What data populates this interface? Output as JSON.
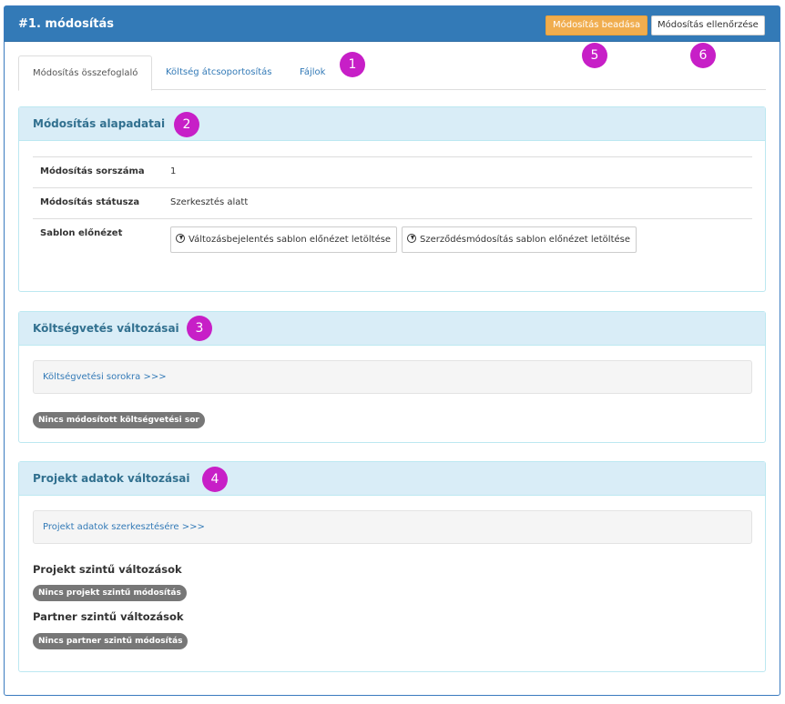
{
  "header": {
    "title": "#1. módosítás",
    "submit_label": "Módosítás beadása",
    "check_label": "Módosítás ellenőrzése"
  },
  "tabs": [
    {
      "label": "Módosítás összefoglaló",
      "active": true
    },
    {
      "label": "Költség átcsoportosítás",
      "active": false
    },
    {
      "label": "Fájlok",
      "active": false
    }
  ],
  "markers": [
    "1",
    "2",
    "3",
    "4",
    "5",
    "6"
  ],
  "basic": {
    "title": "Módosítás alapadatai",
    "rows": [
      {
        "label": "Módosítás sorszáma",
        "value": "1"
      },
      {
        "label": "Módosítás státusza",
        "value": "Szerkesztés alatt"
      },
      {
        "label": "Sablon előnézet"
      }
    ],
    "download_buttons": [
      "Változásbejelentés sablon előnézet letöltése",
      "Szerződésmódosítás sablon előnézet letöltése"
    ]
  },
  "budget": {
    "title": "Költségvetés változásai",
    "link": "Költségvetési sorokra >>>",
    "badge": "Nincs módosított költségvetési sor"
  },
  "project": {
    "title": "Projekt adatok változásai",
    "link": "Projekt adatok szerkesztésére >>>",
    "project_level_heading": "Projekt szintű változások",
    "project_level_badge": "Nincs projekt szintű módosítás",
    "partner_level_heading": "Partner szintű változások",
    "partner_level_badge": "Nincs partner szintű módosítás"
  },
  "colors": {
    "header_bg": "#337ab7",
    "submit_bg": "#f0ad4e",
    "panel_heading_bg": "#d9edf7",
    "marker_bg": "#c71fc7",
    "badge_bg": "#777777"
  }
}
